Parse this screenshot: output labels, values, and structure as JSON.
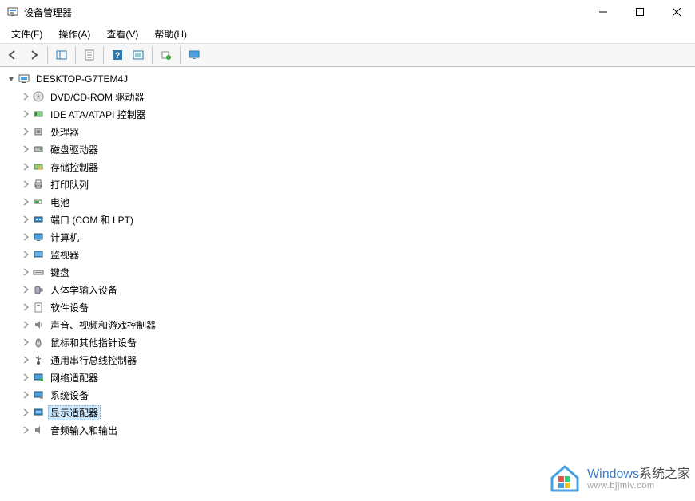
{
  "window": {
    "title": "设备管理器"
  },
  "menu": {
    "file": "文件(F)",
    "action": "操作(A)",
    "view": "查看(V)",
    "help": "帮助(H)"
  },
  "toolbar_icons": {
    "back": "back-arrow",
    "forward": "forward-arrow",
    "show_hide": "show-hide-pane",
    "properties": "properties",
    "help": "help",
    "refresh": "refresh",
    "scan": "scan-hardware",
    "monitor": "monitor"
  },
  "tree": {
    "root": "DESKTOP-G7TEM4J",
    "items": [
      {
        "label": "DVD/CD-ROM 驱动器",
        "icon": "disc"
      },
      {
        "label": "IDE ATA/ATAPI 控制器",
        "icon": "ide"
      },
      {
        "label": "处理器",
        "icon": "cpu"
      },
      {
        "label": "磁盘驱动器",
        "icon": "disk"
      },
      {
        "label": "存储控制器",
        "icon": "storage"
      },
      {
        "label": "打印队列",
        "icon": "printer"
      },
      {
        "label": "电池",
        "icon": "battery"
      },
      {
        "label": "端口 (COM 和 LPT)",
        "icon": "port"
      },
      {
        "label": "计算机",
        "icon": "computer"
      },
      {
        "label": "监视器",
        "icon": "monitor"
      },
      {
        "label": "键盘",
        "icon": "keyboard"
      },
      {
        "label": "人体学输入设备",
        "icon": "hid"
      },
      {
        "label": "软件设备",
        "icon": "software"
      },
      {
        "label": "声音、视频和游戏控制器",
        "icon": "sound"
      },
      {
        "label": "鼠标和其他指针设备",
        "icon": "mouse"
      },
      {
        "label": "通用串行总线控制器",
        "icon": "usb"
      },
      {
        "label": "网络适配器",
        "icon": "network"
      },
      {
        "label": "系统设备",
        "icon": "system"
      },
      {
        "label": "显示适配器",
        "icon": "display",
        "selected": true
      },
      {
        "label": "音频输入和输出",
        "icon": "audio"
      }
    ]
  },
  "watermark": {
    "brand_en": "Windows",
    "brand_cn": "系统之家",
    "url": "www.bjjmlv.com"
  }
}
